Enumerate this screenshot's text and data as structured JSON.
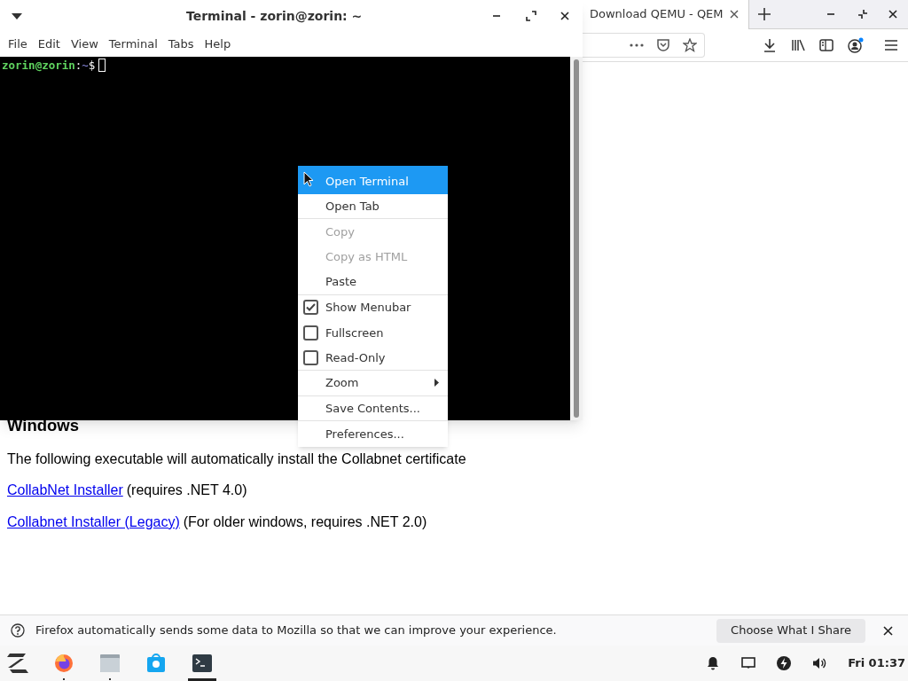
{
  "browser": {
    "tab": {
      "title": "Download QEMU - QEM"
    },
    "page": {
      "heading": "Windows",
      "paragraph": "The following executable will automatically install the Collabnet certificate",
      "links": [
        {
          "link": "CollabNet Installer",
          "note": "(requires .NET 4.0)"
        },
        {
          "link": "Collabnet Installer (Legacy)",
          "note": "(For older windows, requires .NET 2.0)"
        }
      ]
    },
    "notification": {
      "text": "Firefox automatically sends some data to Mozilla so that we can improve your experience.",
      "button": "Choose What I Share"
    }
  },
  "terminal": {
    "title": "Terminal - zorin@zorin: ~",
    "menu": [
      "File",
      "Edit",
      "View",
      "Terminal",
      "Tabs",
      "Help"
    ],
    "prompt": {
      "user": "zorin@zorin",
      "separator": ":",
      "path": "~",
      "symbol": "$"
    }
  },
  "context_menu": [
    {
      "kind": "item",
      "label": "Open Terminal",
      "selected": true,
      "disabled": false,
      "separator_after": false
    },
    {
      "kind": "item",
      "label": "Open Tab",
      "selected": false,
      "disabled": false,
      "separator_after": true
    },
    {
      "kind": "item",
      "label": "Copy",
      "selected": false,
      "disabled": true,
      "separator_after": false
    },
    {
      "kind": "item",
      "label": "Copy as HTML",
      "selected": false,
      "disabled": true,
      "separator_after": false
    },
    {
      "kind": "item",
      "label": "Paste",
      "selected": false,
      "disabled": false,
      "separator_after": true
    },
    {
      "kind": "check",
      "label": "Show Menubar",
      "selected": false,
      "disabled": false,
      "checked": true,
      "separator_after": false
    },
    {
      "kind": "check",
      "label": "Fullscreen",
      "selected": false,
      "disabled": false,
      "checked": false,
      "separator_after": false
    },
    {
      "kind": "check",
      "label": "Read-Only",
      "selected": false,
      "disabled": false,
      "checked": false,
      "separator_after": true
    },
    {
      "kind": "submenu",
      "label": "Zoom",
      "selected": false,
      "disabled": false,
      "separator_after": true
    },
    {
      "kind": "item",
      "label": "Save Contents...",
      "selected": false,
      "disabled": false,
      "separator_after": true
    },
    {
      "kind": "item",
      "label": "Preferences...",
      "selected": false,
      "disabled": false,
      "separator_after": false
    }
  ],
  "taskbar": {
    "apps": [
      {
        "kind": "zorin",
        "running": false,
        "selected": false
      },
      {
        "kind": "firefox",
        "running": true,
        "selected": false
      },
      {
        "kind": "files",
        "running": true,
        "selected": false
      },
      {
        "kind": "store",
        "running": false,
        "selected": false
      },
      {
        "kind": "terminal",
        "running": true,
        "selected": true
      }
    ],
    "clock": "Fri 01:37"
  }
}
